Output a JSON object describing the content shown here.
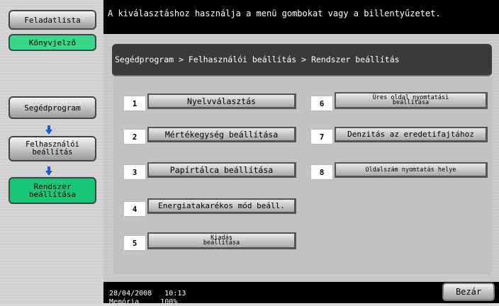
{
  "sidebar": {
    "job_list": "Feladatlista",
    "bookmark": "Könyvjelző",
    "nav": [
      {
        "label": "Segédprogram"
      },
      {
        "label": "Felhasználói beállítás"
      },
      {
        "label": "Rendszer beállítása"
      }
    ]
  },
  "message": "A kiválasztáshoz használja a menü gombokat vagy a billentyűzetet.",
  "breadcrumb": "Segédprogram > Felhasználói beállítás > Rendszer beállítás",
  "options": [
    {
      "num": "1",
      "label": "Nyelvválasztás"
    },
    {
      "num": "2",
      "label": "Mértékegység beállítása"
    },
    {
      "num": "3",
      "label": "Papírtálca beállítása"
    },
    {
      "num": "4",
      "label": "Energiatakarékos mód beáll."
    },
    {
      "num": "5",
      "label": "Kiadás beállítása"
    },
    {
      "num": "6",
      "label": "Üres oldal nyomtatási beállítása"
    },
    {
      "num": "7",
      "label": "Denzitás az eredetifajtához"
    },
    {
      "num": "8",
      "label": "Oldalszám nyomtatás helye"
    }
  ],
  "status": {
    "date": "28/04/2008",
    "time": "10:13",
    "memory_label": "Memória",
    "memory_value": "100%",
    "close_label": "Bezár"
  },
  "colors": {
    "accent_green": "#19c876",
    "arrow_blue": "#1a5bd8"
  }
}
